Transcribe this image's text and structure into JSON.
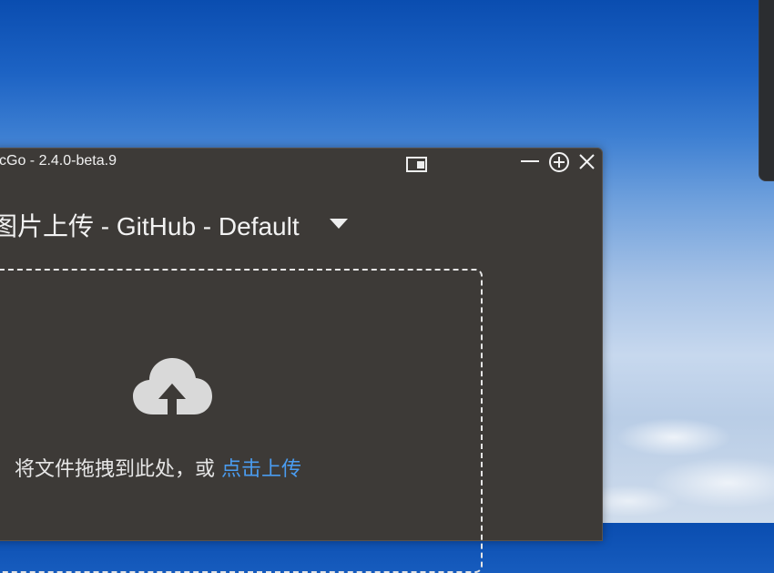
{
  "window": {
    "title": "cGo - 2.4.0-beta.9"
  },
  "upload": {
    "heading": "图片上传 - GitHub - Default",
    "hint_prefix": "将文件拖拽到此处，或 ",
    "hint_link": "点击上传"
  },
  "icons": {
    "mini_window": "mini-window-icon",
    "minimize": "minimize-icon",
    "maximize": "maximize-icon",
    "close": "close-icon",
    "dropdown": "caret-down-icon",
    "upload": "cloud-upload-icon"
  },
  "colors": {
    "window_bg": "#3d3a37",
    "text": "#f2f2f2",
    "link": "#4a9cf0",
    "icon_gray": "#d9d9d9"
  }
}
